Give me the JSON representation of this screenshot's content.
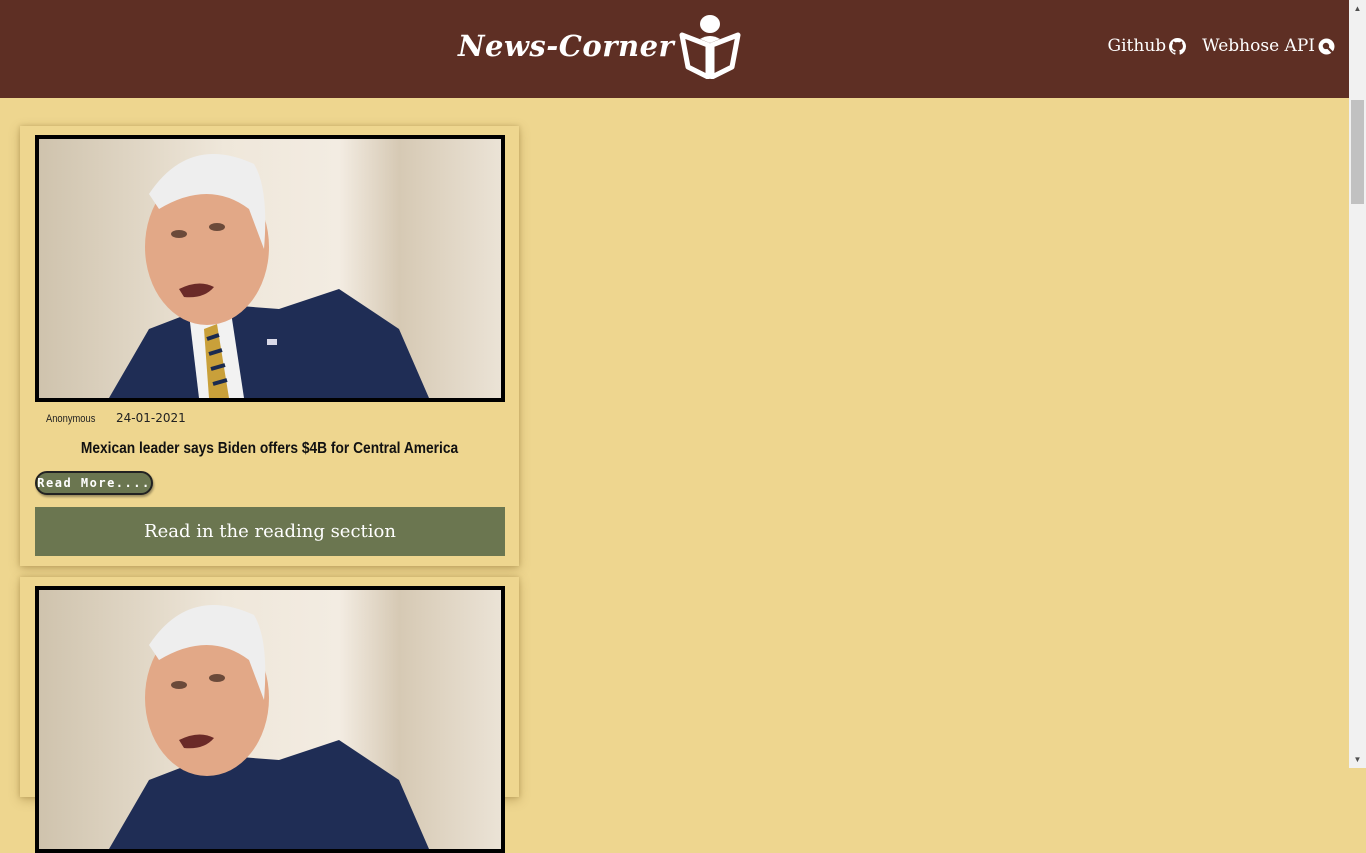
{
  "navbar": {
    "brand": "News-Corner",
    "links": [
      {
        "label": "Github",
        "icon": "github-icon"
      },
      {
        "label": "Webhose API",
        "icon": "webhose-icon"
      }
    ],
    "background": "#5e2f24"
  },
  "page": {
    "background": "#eed68f",
    "accent": "#6b7650"
  },
  "articles": [
    {
      "author": "Anonymous",
      "date": "24-01-2021",
      "title": "Mexican leader says Biden offers $4B for Central America",
      "read_more": "Read More....",
      "reading_section": "Read in the reading section"
    },
    {
      "author": "",
      "date": "",
      "title": "",
      "read_more": "",
      "reading_section": ""
    }
  ]
}
